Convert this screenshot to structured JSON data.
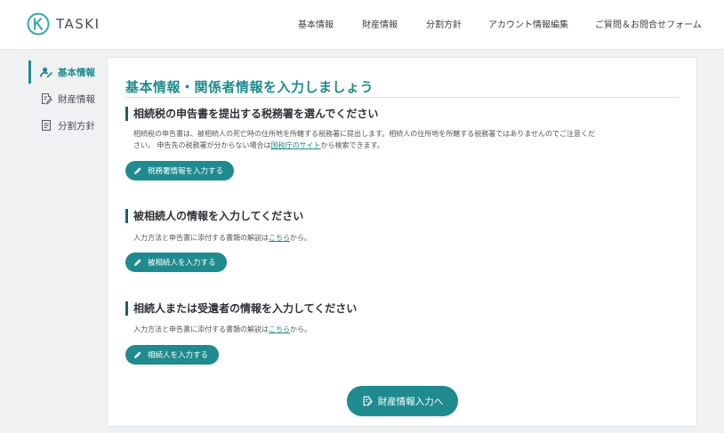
{
  "brand": {
    "name": "TASKI"
  },
  "nav": [
    {
      "label": "基本情報"
    },
    {
      "label": "財産情報"
    },
    {
      "label": "分割方針"
    },
    {
      "label": "アカウント情報編集"
    },
    {
      "label": "ご質問＆お問合せフォーム"
    }
  ],
  "sidebar": {
    "items": [
      {
        "label": "基本情報",
        "icon": "person-icon",
        "active": true
      },
      {
        "label": "財産情報",
        "icon": "document-edit-icon",
        "active": false
      },
      {
        "label": "分割方針",
        "icon": "document-icon",
        "active": false
      }
    ]
  },
  "main": {
    "title": "基本情報・関係者情報を入力しましょう",
    "sections": [
      {
        "heading": "相続税の申告書を提出する税務署を選んでください",
        "desc_line1": "相続税の申告書は、被相続人の死亡時の住所地を所轄する税務署に提出します。相続人の住所地を所轄する税務署ではありませんのでご注意くだ",
        "desc_line2_pre": "さい。 申告先の税務署が分からない場合は",
        "desc_link": "国税庁のサイト",
        "desc_line2_post": "から検索できます。",
        "button": "税務署情報を入力する"
      },
      {
        "heading": "被相続人の情報を入力してください",
        "desc_pre": "入力方法と申告書に添付する書類の解説は",
        "desc_link": "こちら",
        "desc_post": "から。",
        "button": "被相続人を入力する"
      },
      {
        "heading": "相続人または受遺者の情報を入力してください",
        "desc_pre": "入力方法と申告書に添付する書類の解説は",
        "desc_link": "こちら",
        "desc_post": "から。",
        "button": "相続人を入力する"
      }
    ],
    "next_button": "財産情報入力へ"
  },
  "colors": {
    "accent": "#1f8b8e",
    "heading_bar": "#1f5f66",
    "background": "#eff1f3"
  }
}
